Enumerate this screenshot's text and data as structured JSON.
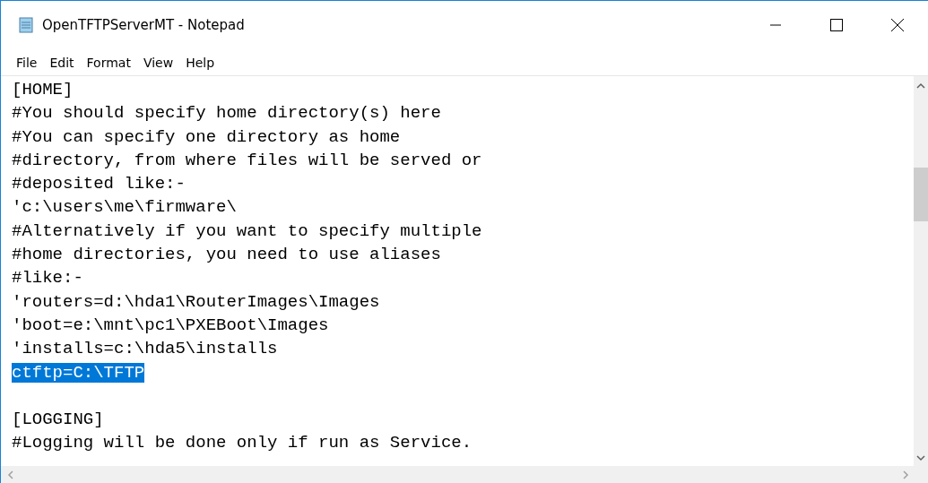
{
  "window": {
    "title": "OpenTFTPServerMT - Notepad"
  },
  "menu": [
    "File",
    "Edit",
    "Format",
    "View",
    "Help"
  ],
  "lines": [
    {
      "kind": "text",
      "text": "[HOME]",
      "selected": false
    },
    {
      "kind": "text",
      "text": "#You should specify home directory(s) here",
      "selected": false
    },
    {
      "kind": "text",
      "text": "#You can specify one directory as home",
      "selected": false
    },
    {
      "kind": "text",
      "text": "#directory, from where files will be served or",
      "selected": false
    },
    {
      "kind": "text",
      "text": "#deposited like:-",
      "selected": false
    },
    {
      "kind": "text",
      "text": "'c:\\users\\me\\firmware\\",
      "selected": false
    },
    {
      "kind": "text",
      "text": "#Alternatively if you want to specify multiple",
      "selected": false
    },
    {
      "kind": "text",
      "text": "#home directories, you need to use aliases",
      "selected": false
    },
    {
      "kind": "text",
      "text": "#like:-",
      "selected": false
    },
    {
      "kind": "text",
      "text": "'routers=d:\\hda1\\RouterImages\\Images",
      "selected": false
    },
    {
      "kind": "text",
      "text": "'boot=e:\\mnt\\pc1\\PXEBoot\\Images",
      "selected": false
    },
    {
      "kind": "text",
      "text": "'installs=c:\\hda5\\installs",
      "selected": false
    },
    {
      "kind": "text",
      "text": "ctftp=C:\\TFTP",
      "selected": true
    },
    {
      "kind": "blank"
    },
    {
      "kind": "text",
      "text": "[LOGGING]",
      "selected": false
    },
    {
      "kind": "text",
      "text": "#Logging will be done only if run as Service.",
      "selected": false
    }
  ]
}
